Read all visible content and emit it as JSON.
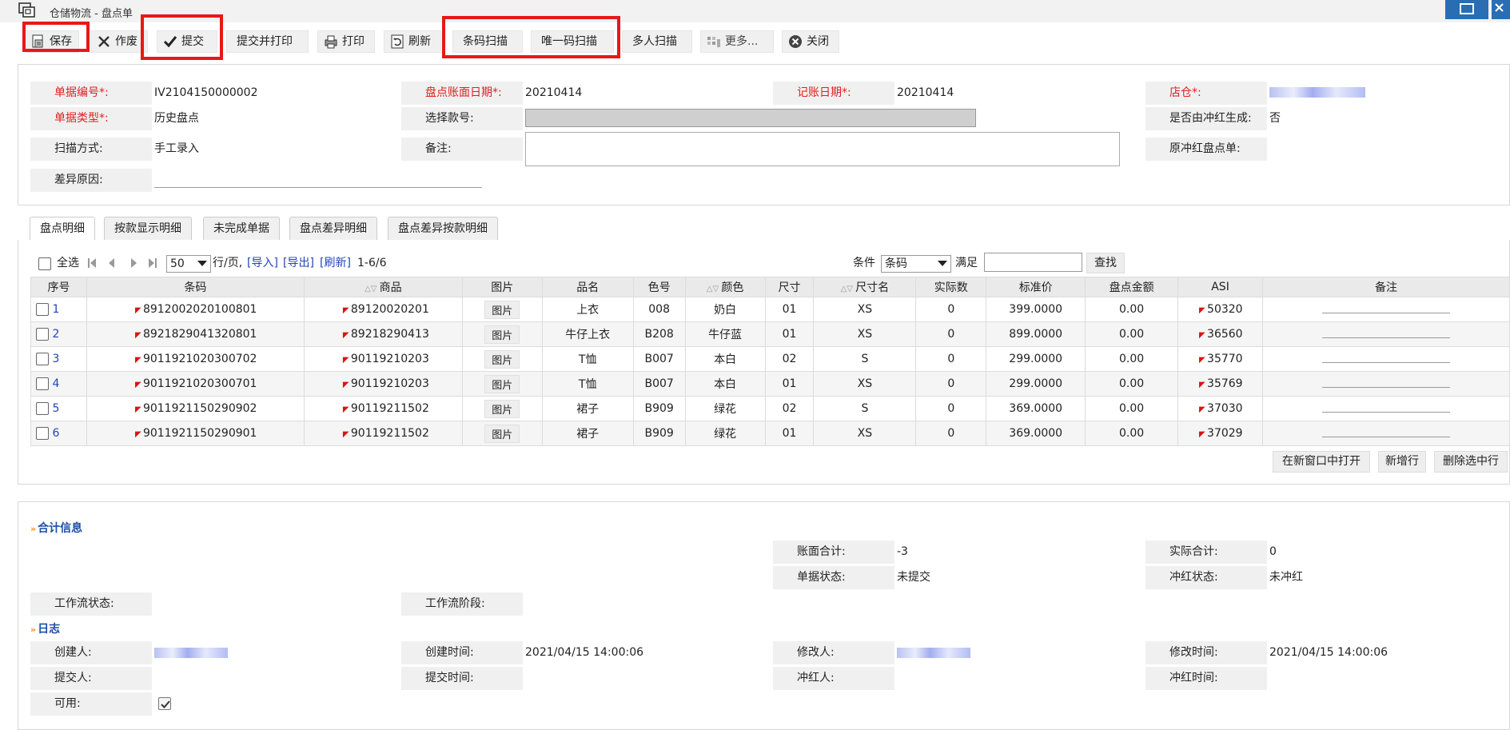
{
  "window": {
    "title": "仓储物流 - 盘点单"
  },
  "toolbar": {
    "save": "保存",
    "void": "作废",
    "submit": "提交",
    "submit_print": "提交并打印",
    "print": "打印",
    "refresh": "刷新",
    "barcode_scan": "条码扫描",
    "unique_scan": "唯一码扫描",
    "multi_scan": "多人扫描",
    "more": "更多...",
    "close": "关闭"
  },
  "header": {
    "doc_no_label": "单据编号*:",
    "doc_no": "IV2104150000002",
    "book_date_label": "盘点账面日期*:",
    "book_date": "20210414",
    "post_date_label": "记账日期*:",
    "post_date": "20210414",
    "store_label": "店仓*:",
    "doc_type_label": "单据类型*:",
    "doc_type": "历史盘点",
    "select_style_label": "选择款号:",
    "is_reversal_label": "是否由冲红生成:",
    "is_reversal": "否",
    "scan_mode_label": "扫描方式:",
    "scan_mode": "手工录入",
    "remark_label": "备注:",
    "orig_doc_label": "原冲红盘点单:",
    "diff_reason_label": "差异原因:"
  },
  "tabs": [
    "盘点明细",
    "按款显示明细",
    "未完成单据",
    "盘点差异明细",
    "盘点差异按款明细"
  ],
  "pager": {
    "select_all": "全选",
    "page_size": "50",
    "per_page": "行/页,",
    "import": "[导入]",
    "export": "[导出]",
    "refresh": "[刷新]",
    "range": "1-6/6",
    "condition_label": "条件",
    "condition_value": "条码",
    "satisfy_label": "满足",
    "search": "查找"
  },
  "table": {
    "columns": [
      "序号",
      "条码",
      "商品",
      "图片",
      "品名",
      "色号",
      "颜色",
      "尺寸",
      "尺寸名",
      "实际数",
      "标准价",
      "盘点金额",
      "ASI",
      "备注"
    ],
    "pic_label": "图片",
    "rows": [
      {
        "no": "1",
        "barcode": "8912002020100801",
        "product": "89120020201",
        "name": "上衣",
        "color_no": "008",
        "color": "奶白",
        "size": "01",
        "size_name": "XS",
        "qty": "0",
        "price": "399.0000",
        "amount": "0.00",
        "asi": "50320"
      },
      {
        "no": "2",
        "barcode": "8921829041320801",
        "product": "89218290413",
        "name": "牛仔上衣",
        "color_no": "B208",
        "color": "牛仔蓝",
        "size": "01",
        "size_name": "XS",
        "qty": "0",
        "price": "899.0000",
        "amount": "0.00",
        "asi": "36560"
      },
      {
        "no": "3",
        "barcode": "9011921020300702",
        "product": "90119210203",
        "name": "T恤",
        "color_no": "B007",
        "color": "本白",
        "size": "02",
        "size_name": "S",
        "qty": "0",
        "price": "299.0000",
        "amount": "0.00",
        "asi": "35770"
      },
      {
        "no": "4",
        "barcode": "9011921020300701",
        "product": "90119210203",
        "name": "T恤",
        "color_no": "B007",
        "color": "本白",
        "size": "01",
        "size_name": "XS",
        "qty": "0",
        "price": "299.0000",
        "amount": "0.00",
        "asi": "35769"
      },
      {
        "no": "5",
        "barcode": "9011921150290902",
        "product": "90119211502",
        "name": "裙子",
        "color_no": "B909",
        "color": "绿花",
        "size": "02",
        "size_name": "S",
        "qty": "0",
        "price": "369.0000",
        "amount": "0.00",
        "asi": "37030"
      },
      {
        "no": "6",
        "barcode": "9011921150290901",
        "product": "90119211502",
        "name": "裙子",
        "color_no": "B909",
        "color": "绿花",
        "size": "01",
        "size_name": "XS",
        "qty": "0",
        "price": "369.0000",
        "amount": "0.00",
        "asi": "37029"
      }
    ],
    "open_new_window": "在新窗口中打开",
    "add_row": "新增行",
    "delete_rows": "删除选中行"
  },
  "summary": {
    "title": "合计信息",
    "book_total_label": "账面合计:",
    "book_total": "-3",
    "actual_total_label": "实际合计:",
    "actual_total": "0",
    "doc_status_label": "单据状态:",
    "doc_status": "未提交",
    "reversal_status_label": "冲红状态:",
    "reversal_status": "未冲红",
    "wf_status_label": "工作流状态:",
    "wf_stage_label": "工作流阶段:"
  },
  "log": {
    "title": "日志",
    "creator_label": "创建人:",
    "created_label": "创建时间:",
    "created": "2021/04/15 14:00:06",
    "modifier_label": "修改人:",
    "modified_label": "修改时间:",
    "modified": "2021/04/15 14:00:06",
    "submitter_label": "提交人:",
    "submitted_label": "提交时间:",
    "reverser_label": "冲红人:",
    "reversed_label": "冲红时间:",
    "enabled_label": "可用:"
  },
  "colors": {
    "required_label": "#e02020",
    "link": "#2244bb",
    "highlight_box": "#e81818",
    "section_title": "#1d4ea6"
  }
}
